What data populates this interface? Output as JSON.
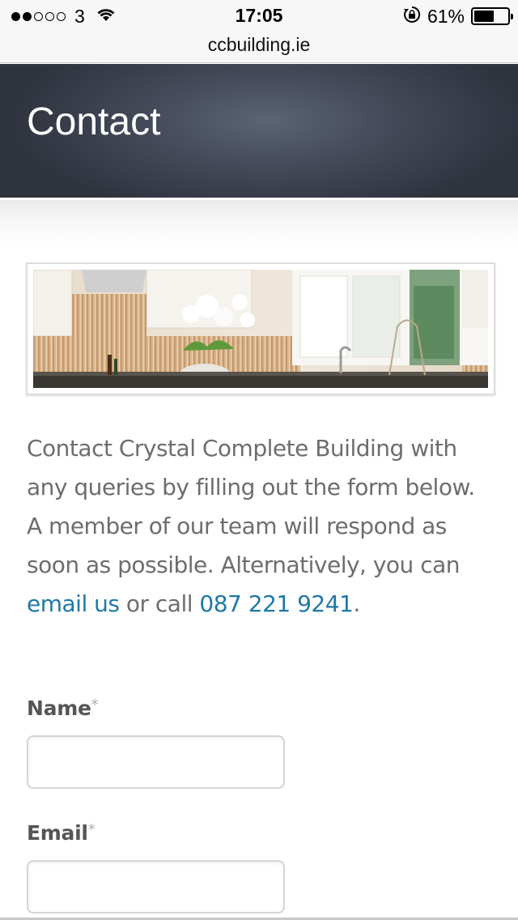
{
  "status_bar": {
    "signal_dots_filled": 2,
    "signal_dots_total": 5,
    "carrier": "3",
    "time": "17:05",
    "battery_pct": "61%",
    "battery_level": 0.61
  },
  "browser": {
    "url": "ccbuilding.ie"
  },
  "header": {
    "title": "Contact",
    "bg_color": "#3e4350"
  },
  "intro": {
    "text_before": "Contact Crystal Complete Building with any queries by filling out the form below. A member of our team will respond as soon as possible. Alternatively, you can ",
    "email_link": "email us",
    "text_mid": " or call ",
    "phone_link": "087 221 9241",
    "text_after": ".",
    "link_color": "#1f78a8"
  },
  "form": {
    "name_label": "Name",
    "email_label": "Email",
    "required_mark": "*",
    "name_value": "",
    "email_value": ""
  }
}
